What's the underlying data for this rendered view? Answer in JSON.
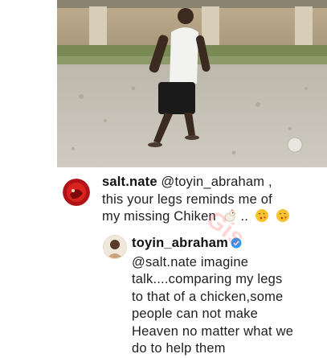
{
  "post": {
    "video_frame": "video-thumbnail"
  },
  "comments": [
    {
      "username": "salt.nate",
      "mention": "@toyin_abraham",
      "line1_tail": " ,",
      "line2": "this your legs reminds me of",
      "line3": "my missing Chiken",
      "line3_tail": " ..",
      "emojis": [
        "chicken-emoji",
        "kiss-emoji",
        "kiss-emoji"
      ]
    },
    {
      "username": "toyin_abraham",
      "verified_icon": "verified-badge-icon",
      "mention": "@salt.nate",
      "line2_tail": " imagine",
      "line3": "talk....comparing my legs",
      "line4": "to that of a chicken,some",
      "line5": "people can not make",
      "line6": "Heaven no matter what we",
      "line7": "do to help them"
    }
  ],
  "colors": {
    "verified": "#3897f0",
    "watermark": "#eb463c"
  }
}
